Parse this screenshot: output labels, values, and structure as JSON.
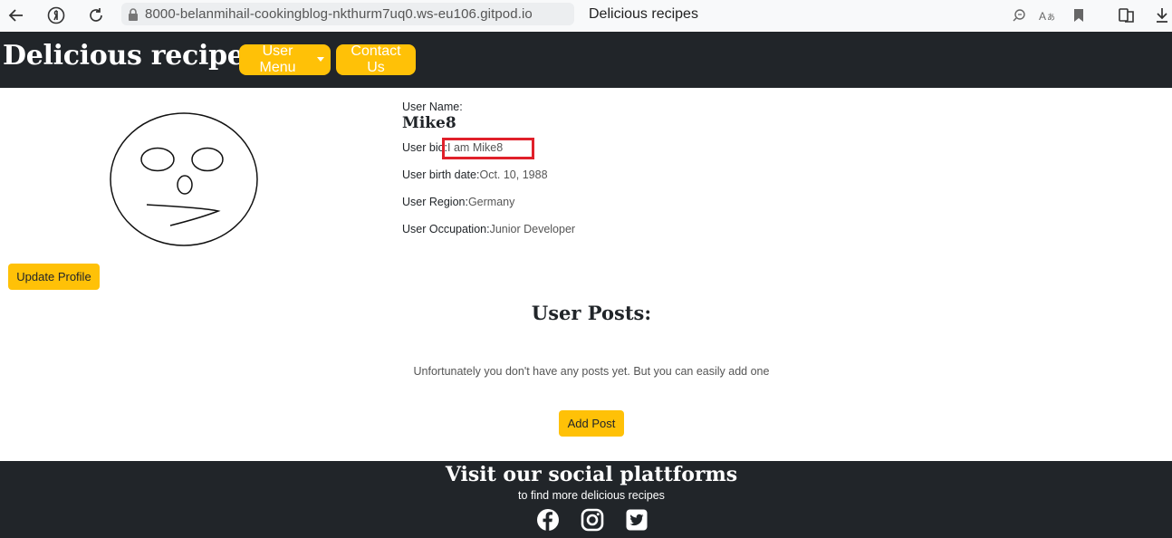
{
  "browser": {
    "url": "8000-belanmihail-cookingblog-nkthurm7uq0.ws-eu106.gitpod.io",
    "tab_title": "Delicious recipes"
  },
  "nav": {
    "brand": "Delicious recipes",
    "user_menu": "User Menu",
    "contact": "Contact Us"
  },
  "profile": {
    "update_button": "Update Profile",
    "user_name_label": "User Name:",
    "user_name": "Mike8",
    "bio_label": "User bio:",
    "bio": "I am Mike8",
    "birth_label": "User birth date:",
    "birth": "Oct. 10, 1988",
    "region_label": "User Region:",
    "region": "Germany",
    "occupation_label": "User Occupation:",
    "occupation": "Junior Developer"
  },
  "posts": {
    "title": "User Posts:",
    "empty_message": "Unfortunately you don't have any posts yet. But you can easily add one",
    "add_button": "Add Post"
  },
  "footer": {
    "title": "Visit our social plattforms",
    "subtitle": "to find more delicious recipes",
    "icons": [
      "facebook-icon",
      "instagram-icon",
      "twitter-icon"
    ]
  },
  "colors": {
    "accent": "#ffc107",
    "dark": "#212529",
    "highlight": "#e0202a"
  }
}
